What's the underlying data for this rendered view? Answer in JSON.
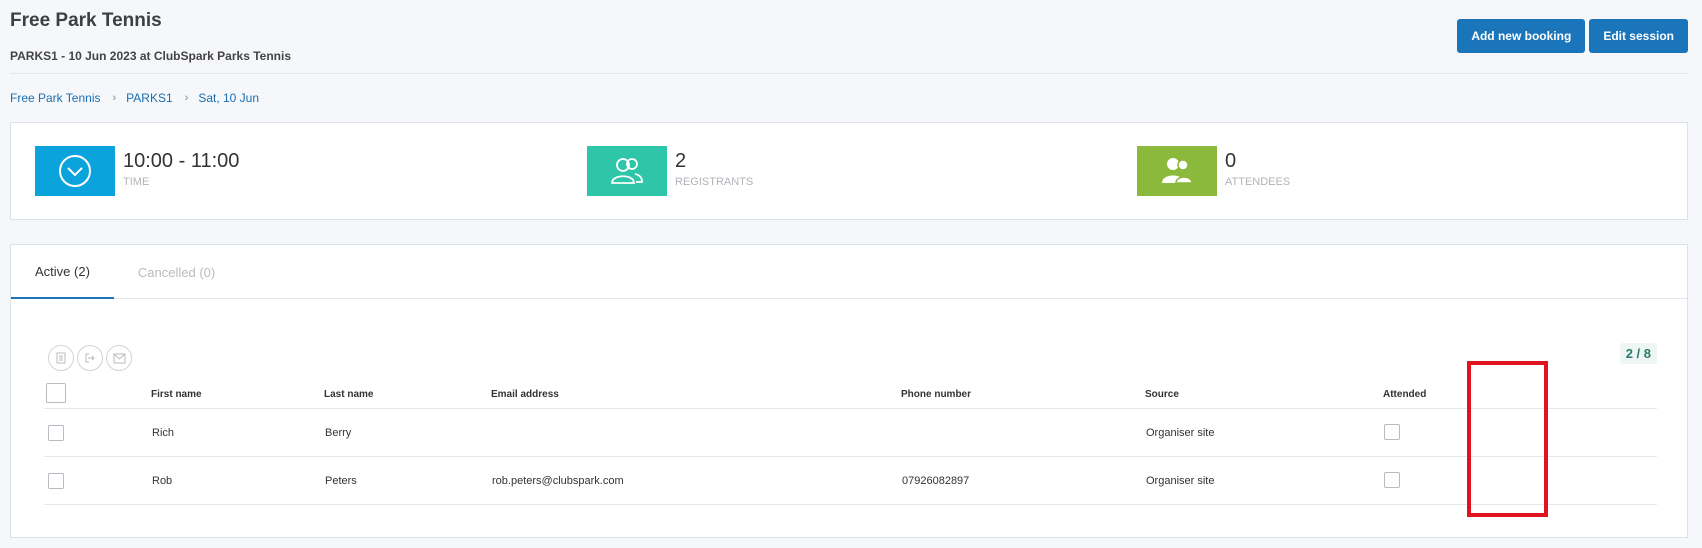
{
  "header": {
    "title": "Free Park Tennis",
    "subtitle": "PARKS1 - 10 Jun 2023 at ClubSpark Parks Tennis",
    "add_booking_label": "Add new booking",
    "edit_session_label": "Edit session"
  },
  "breadcrumb": {
    "items": [
      "Free Park Tennis",
      "PARKS1",
      "Sat, 10 Jun"
    ],
    "separator": "›"
  },
  "stats": {
    "time": {
      "value": "10:00 - 11:00",
      "label": "TIME",
      "color": "#0aa3dc",
      "icon": "clock-icon"
    },
    "registrants": {
      "value": "2",
      "label": "REGISTRANTS",
      "color": "#2fc5a8",
      "icon": "users-icon"
    },
    "attendees": {
      "value": "0",
      "label": "ATTENDEES",
      "color": "#8ab93b",
      "icon": "user-group-icon"
    }
  },
  "tabs": [
    {
      "label": "Active (2)",
      "active": true
    },
    {
      "label": "Cancelled (0)",
      "active": false
    }
  ],
  "table": {
    "count": "2 / 8",
    "tools": [
      "print-icon",
      "export-icon",
      "email-icon"
    ],
    "columns": [
      "First name",
      "Last name",
      "Email address",
      "Phone number",
      "Source",
      "Attended"
    ],
    "rows": [
      {
        "first": "Rich",
        "last": "Berry",
        "email": "",
        "phone": "",
        "source": "Organiser site",
        "attended": false
      },
      {
        "first": "Rob",
        "last": "Peters",
        "email": "rob.peters@clubspark.com",
        "phone": "07926082897",
        "source": "Organiser site",
        "attended": false
      }
    ]
  },
  "colors": {
    "primary": "#1a75bb",
    "highlight": "#e0141e"
  }
}
